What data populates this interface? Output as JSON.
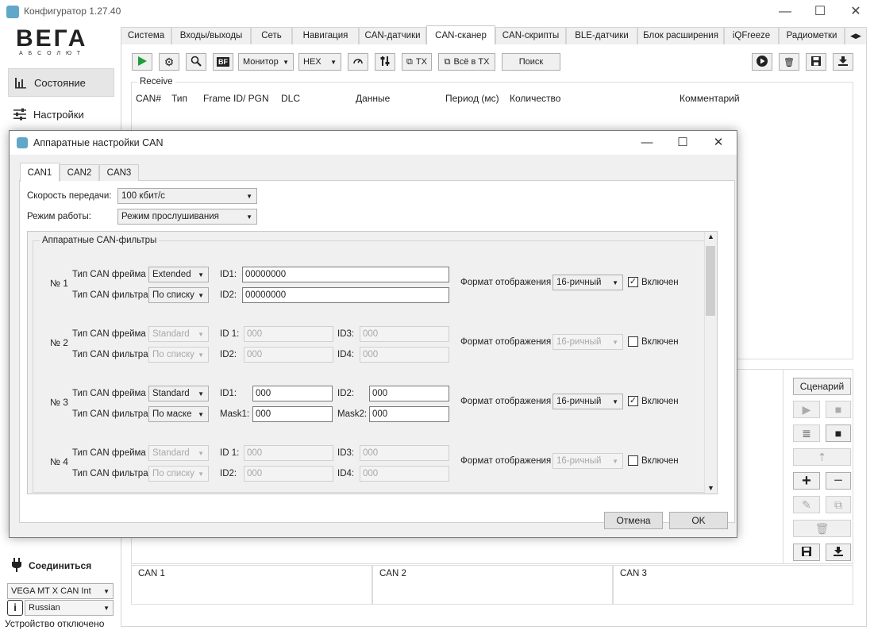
{
  "window": {
    "title": "Конфигуратор 1.27.40",
    "controls": {
      "minimize": "—",
      "maximize": "☐",
      "close": "✕"
    }
  },
  "sidebar": {
    "logo_main": "ВЕГА",
    "logo_sub": "АБСОЛЮТ",
    "items": [
      {
        "label": "Состояние",
        "icon": "bar-chart-icon"
      },
      {
        "label": "Настройки",
        "icon": "sliders-icon"
      }
    ],
    "connect_label": "Соединиться",
    "device": "VEGA MT X CAN Int",
    "language": "Russian",
    "status": "Устройство отключено"
  },
  "tabs": [
    "Система",
    "Входы/выходы",
    "Сеть",
    "Навигация",
    "CAN-датчики",
    "CAN-сканер",
    "CAN-скрипты",
    "BLE-датчики",
    "Блок расширения",
    "iQFreeze",
    "Радиометки"
  ],
  "active_tab": "CAN-сканер",
  "toolbar": {
    "monitor": "Монитор",
    "format": "HEX",
    "tx": "TX",
    "all_tx": "Всё в TX",
    "search": "Поиск",
    "bf": "BF"
  },
  "receive": {
    "label": "Receive",
    "columns": [
      "CAN#",
      "Тип",
      "Frame ID/ PGN",
      "DLC",
      "Данные",
      "Период (мс)",
      "Количество",
      "Комментарий"
    ]
  },
  "right_panel": {
    "scenario": "Сценарий"
  },
  "can_boxes": [
    "CAN 1",
    "CAN 2",
    "CAN 3"
  ],
  "dialog": {
    "title": "Аппаратные настройки CAN",
    "tabs": [
      "CAN1",
      "CAN2",
      "CAN3"
    ],
    "speed_label": "Скорость передачи:",
    "speed_value": "100 кбит/с",
    "mode_label": "Режим работы:",
    "mode_value": "Режим прослушивания",
    "filters_title": "Аппаратные CAN-фильтры",
    "frame_type_label": "Тип CAN фрейма",
    "filter_type_label": "Тип CAN фильтра",
    "display_format_label": "Формат отображения",
    "enabled_label": "Включен",
    "filters": [
      {
        "num": "№ 1",
        "frame": "Extended",
        "filter": "По списку",
        "l1": "ID1:",
        "v1": "00000000",
        "l2": "ID2:",
        "v2": "00000000",
        "format": "16-ричный",
        "enabled": "✓"
      },
      {
        "num": "№ 2",
        "frame": "Standard",
        "filter": "По списку",
        "l1": "ID 1:",
        "v1": "000",
        "l2": "ID2:",
        "v2": "000",
        "l3": "ID3:",
        "v3": "000",
        "l4": "ID4:",
        "v4": "000",
        "format": "16-ричный",
        "enabled": ""
      },
      {
        "num": "№ 3",
        "frame": "Standard",
        "filter": "По маске",
        "l1": "ID1:",
        "v1": "000",
        "l2": "Mask1:",
        "v2": "000",
        "l3": "ID2:",
        "v3": "000",
        "l4": "Mask2:",
        "v4": "000",
        "format": "16-ричный",
        "enabled": "✓"
      },
      {
        "num": "№ 4",
        "frame": "Standard",
        "filter": "По списку",
        "l1": "ID 1:",
        "v1": "000",
        "l2": "ID2:",
        "v2": "000",
        "l3": "ID3:",
        "v3": "000",
        "l4": "ID4:",
        "v4": "000",
        "format": "16-ричный",
        "enabled": ""
      }
    ],
    "cancel": "Отмена",
    "ok": "OK"
  }
}
